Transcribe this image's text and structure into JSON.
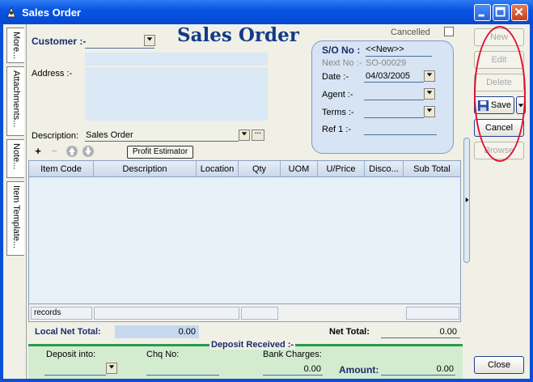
{
  "window": {
    "title": "Sales Order"
  },
  "side_tabs": [
    "More...",
    "Attachments...",
    "Note...",
    "Item Template..."
  ],
  "header": {
    "heading": "Sales Order",
    "cancelled_label": "Cancelled"
  },
  "form": {
    "customer_label": "Customer :-",
    "address_label": "Address :-",
    "description_label": "Description:",
    "description_value": "Sales Order",
    "profit_estimator": "Profit Estimator"
  },
  "so_box": {
    "so_no_label": "S/O No :",
    "so_no_value": "<<New>>",
    "next_no_label": "Next No :-",
    "next_no_value": "SO-00029",
    "date_label": "Date :-",
    "date_value": "04/03/2005",
    "agent_label": "Agent :-",
    "terms_label": "Terms :-",
    "ref1_label": "Ref 1 :-"
  },
  "grid": {
    "columns": [
      "Item Code",
      "Description",
      "Location",
      "Qty",
      "UOM",
      "U/Price",
      "Disco...",
      "Sub Total"
    ],
    "footer_records": "records"
  },
  "totals": {
    "local_net_total_label": "Local Net Total:",
    "local_net_total_value": "0.00",
    "net_total_label": "Net Total:",
    "net_total_value": "0.00"
  },
  "deposit": {
    "heading": "Deposit Received :-",
    "deposit_into_label": "Deposit into:",
    "chq_no_label": "Chq No:",
    "bank_charges_label": "Bank Charges:",
    "bank_charges_value": "0.00",
    "amount_label": "Amount:",
    "amount_value": "0.00"
  },
  "buttons": {
    "new": "New",
    "edit": "Edit",
    "delete": "Delete",
    "save": "Save",
    "cancel": "Cancel",
    "browse": "Browse",
    "close": "Close"
  },
  "colors": {
    "titlebar": "#0a55e4",
    "heading": "#123a8a",
    "deposit_bar": "#2a9a4e",
    "annotation": "#e01030"
  },
  "icons": [
    "app-icon",
    "minimize-icon",
    "maximize-icon",
    "close-icon",
    "add-row-icon",
    "remove-row-icon",
    "move-up-icon",
    "move-down-icon",
    "save-disk-icon",
    "dropdown-arrow-icon"
  ]
}
